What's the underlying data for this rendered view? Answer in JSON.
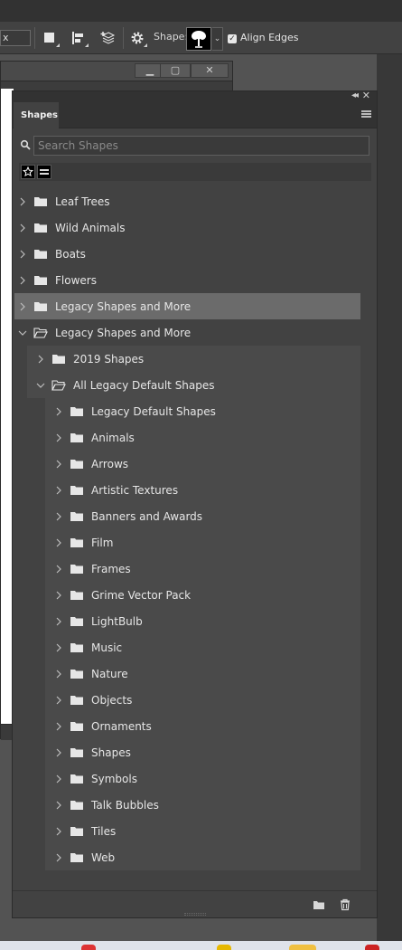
{
  "options_bar": {
    "partial_field": "x",
    "shape_label": "Shape:",
    "align_edges_label": "Align Edges",
    "align_edges_checked": true
  },
  "doc_window": {
    "minimize": "▁",
    "restore": "▢",
    "close": "✕"
  },
  "panel": {
    "tab_label": "Shapes",
    "search_placeholder": "Search Shapes",
    "tree": [
      {
        "label": "Leaf Trees",
        "level": 0,
        "expanded": false,
        "selected": false
      },
      {
        "label": "Wild Animals",
        "level": 0,
        "expanded": false,
        "selected": false
      },
      {
        "label": "Boats",
        "level": 0,
        "expanded": false,
        "selected": false
      },
      {
        "label": "Flowers",
        "level": 0,
        "expanded": false,
        "selected": false
      },
      {
        "label": "Legacy Shapes and More",
        "level": 0,
        "expanded": false,
        "selected": true
      },
      {
        "label": "Legacy Shapes and More",
        "level": 0,
        "expanded": true,
        "selected": false
      },
      {
        "label": "2019 Shapes",
        "level": 1,
        "expanded": false,
        "selected": false
      },
      {
        "label": "All Legacy Default Shapes",
        "level": 1,
        "expanded": true,
        "selected": false
      },
      {
        "label": "Legacy Default Shapes",
        "level": 2,
        "expanded": false,
        "selected": false
      },
      {
        "label": "Animals",
        "level": 2,
        "expanded": false,
        "selected": false
      },
      {
        "label": "Arrows",
        "level": 2,
        "expanded": false,
        "selected": false
      },
      {
        "label": "Artistic Textures",
        "level": 2,
        "expanded": false,
        "selected": false
      },
      {
        "label": "Banners and Awards",
        "level": 2,
        "expanded": false,
        "selected": false
      },
      {
        "label": "Film",
        "level": 2,
        "expanded": false,
        "selected": false
      },
      {
        "label": "Frames",
        "level": 2,
        "expanded": false,
        "selected": false
      },
      {
        "label": "Grime Vector Pack",
        "level": 2,
        "expanded": false,
        "selected": false
      },
      {
        "label": "LightBulb",
        "level": 2,
        "expanded": false,
        "selected": false
      },
      {
        "label": "Music",
        "level": 2,
        "expanded": false,
        "selected": false
      },
      {
        "label": "Nature",
        "level": 2,
        "expanded": false,
        "selected": false
      },
      {
        "label": "Objects",
        "level": 2,
        "expanded": false,
        "selected": false
      },
      {
        "label": "Ornaments",
        "level": 2,
        "expanded": false,
        "selected": false
      },
      {
        "label": "Shapes",
        "level": 2,
        "expanded": false,
        "selected": false
      },
      {
        "label": "Symbols",
        "level": 2,
        "expanded": false,
        "selected": false
      },
      {
        "label": "Talk Bubbles",
        "level": 2,
        "expanded": false,
        "selected": false
      },
      {
        "label": "Tiles",
        "level": 2,
        "expanded": false,
        "selected": false
      },
      {
        "label": "Web",
        "level": 2,
        "expanded": false,
        "selected": false
      }
    ]
  },
  "colors": {
    "panel_bg": "#424242",
    "selected_row": "#6b6b6b",
    "text": "#e6e6e6"
  }
}
